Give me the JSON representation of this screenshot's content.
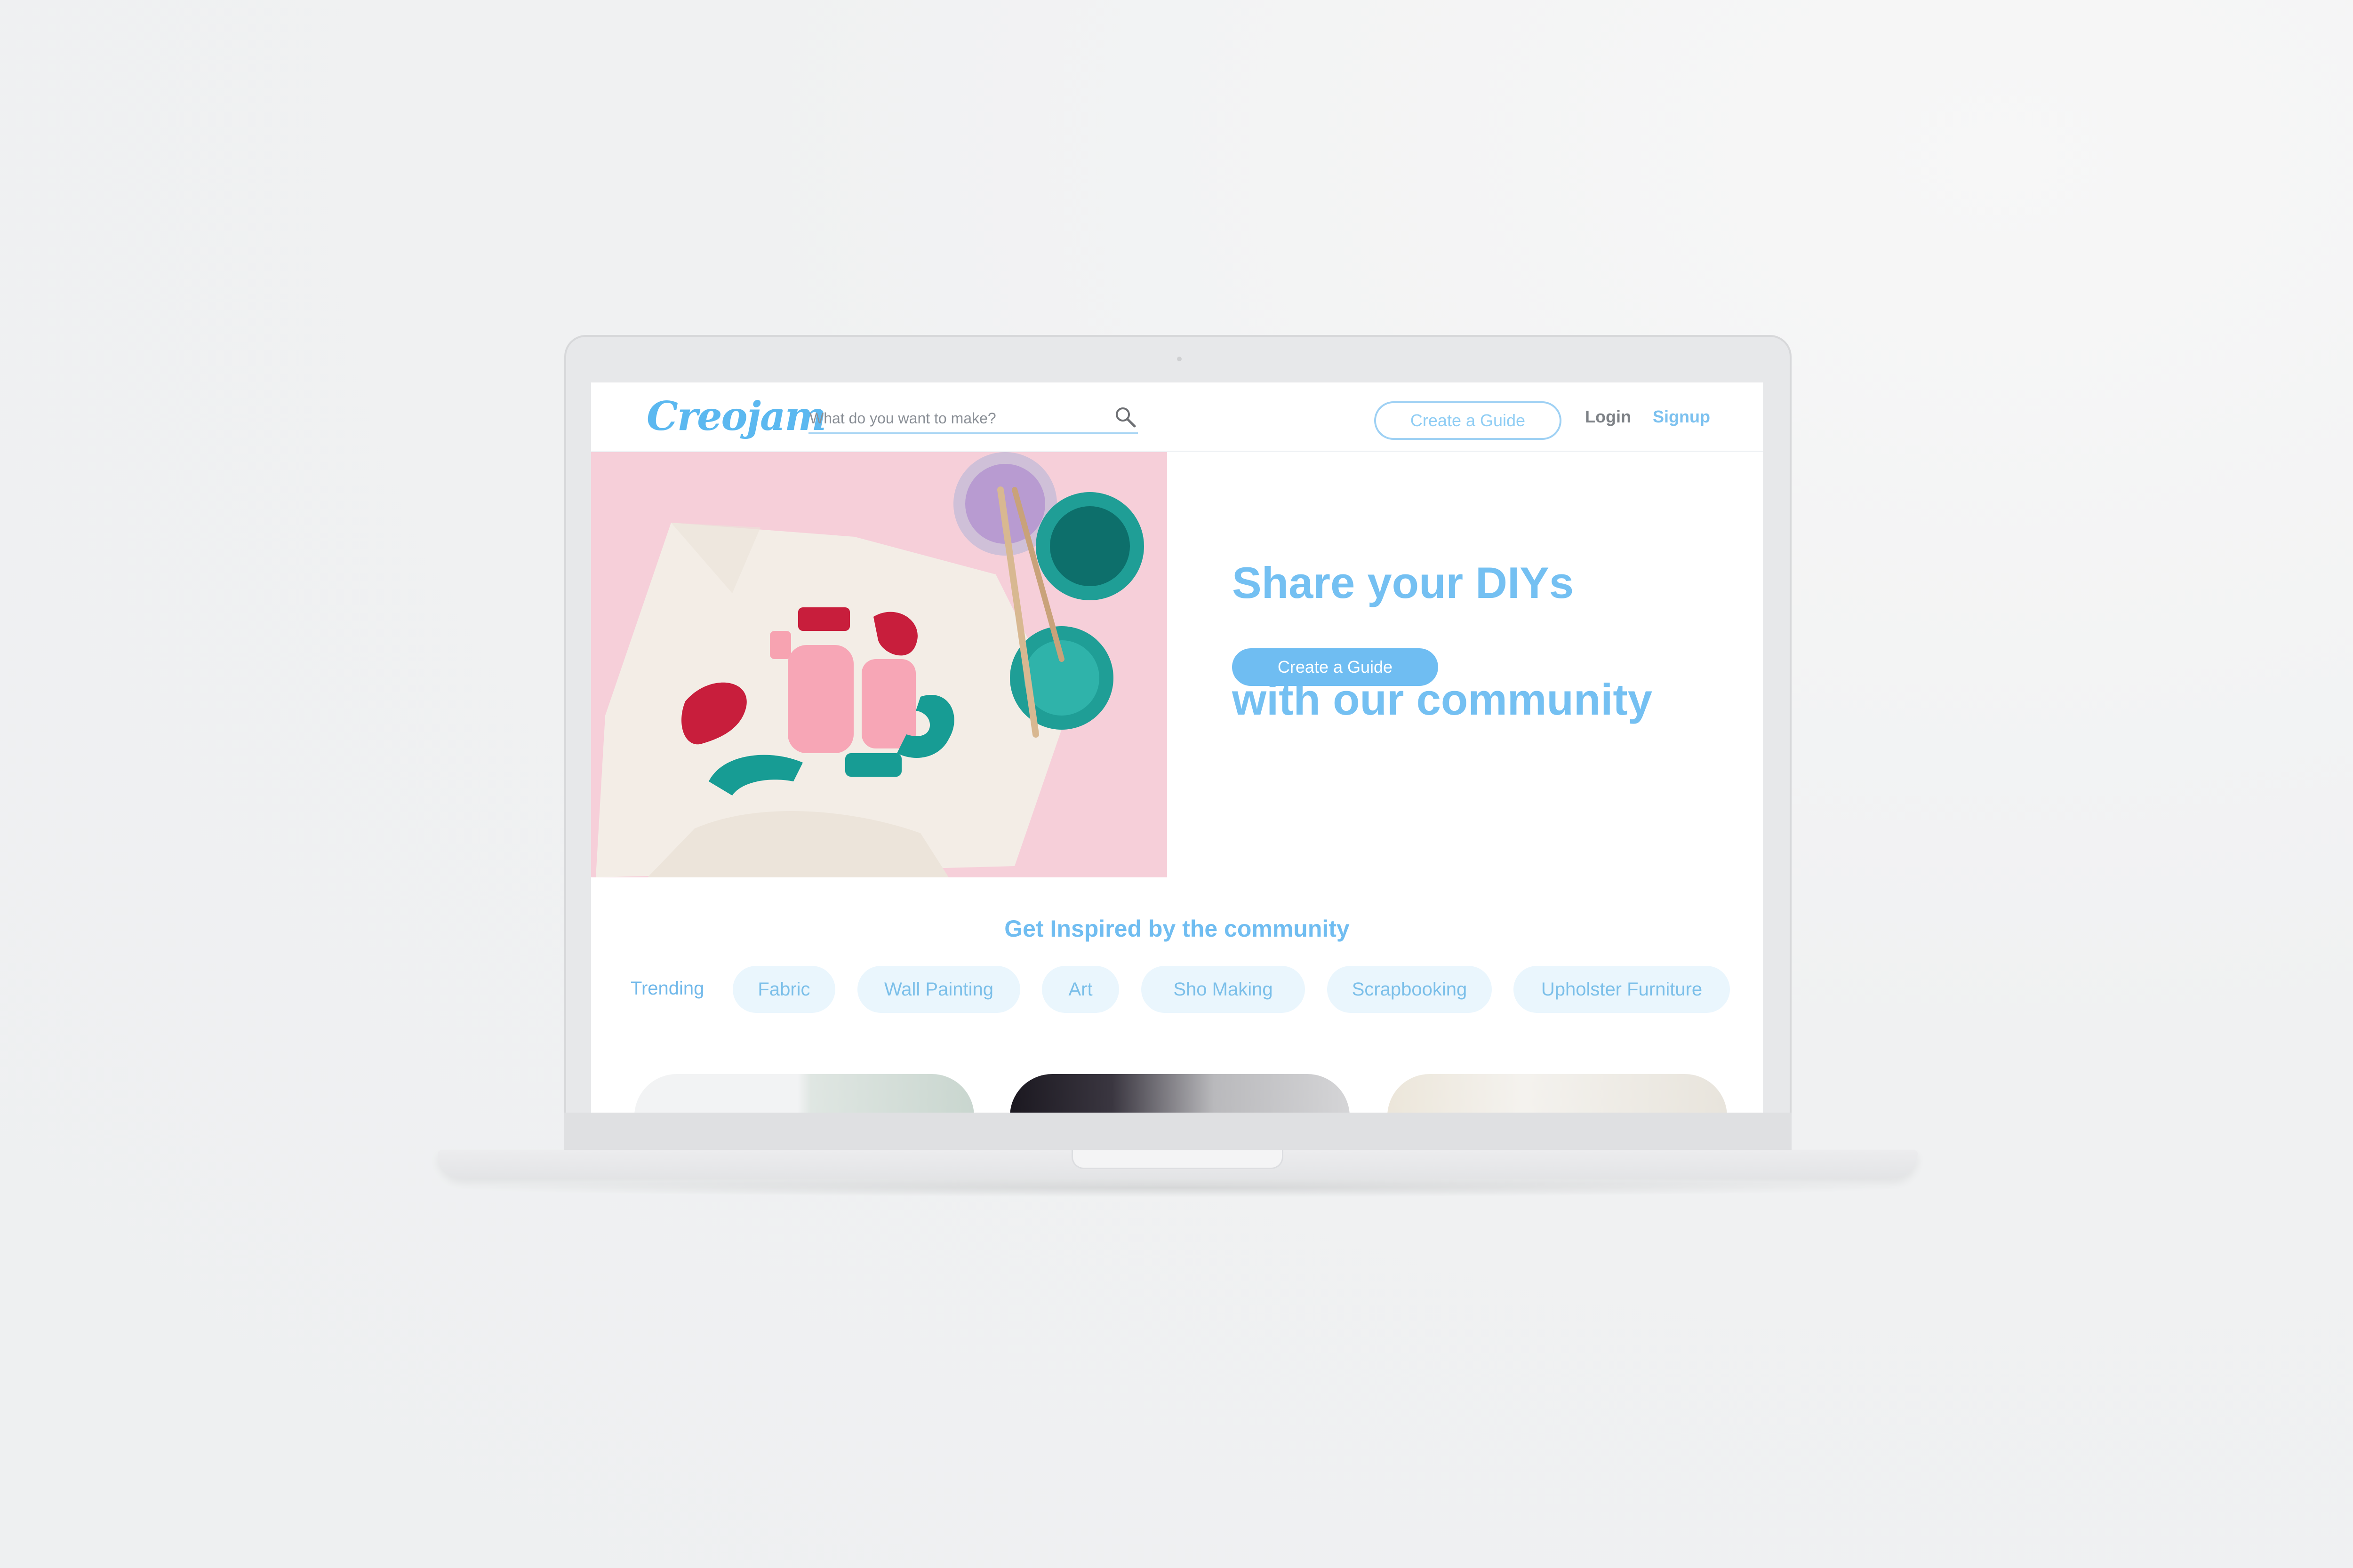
{
  "nav": {
    "logo": "Creojam",
    "search_placeholder": "What do you want to make?",
    "create_guide": "Create a Guide",
    "login": "Login",
    "signup": "Signup"
  },
  "hero": {
    "title_line1": "Share your DIYs",
    "title_line2": "with our community",
    "cta": "Create a Guide"
  },
  "inspire": {
    "title": "Get Inspired by the community",
    "trending_label": "Trending",
    "tags": [
      "Fabric",
      "Wall Painting",
      "Art",
      "Sho Making",
      "Scrapbooking",
      "Upholster Furniture"
    ]
  },
  "colors": {
    "accent": "#6fbdf2",
    "tag_bg": "#eaf6fd",
    "hero_bg": "#f6cfd9"
  }
}
